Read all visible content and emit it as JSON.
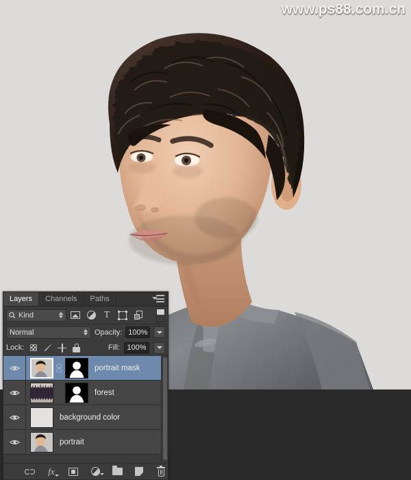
{
  "watermark": {
    "text": "www.ps88.com.cn",
    "sub": "www"
  },
  "canvas": {
    "background_color": "#dcdbd9",
    "outside_color": "#2a2a2a",
    "subject": "portrait photo of young man with curly dark hair wearing gray mandarin-collar shirt"
  },
  "panel": {
    "tabs": [
      {
        "label": "Layers",
        "active": true
      },
      {
        "label": "Channels",
        "active": false
      },
      {
        "label": "Paths",
        "active": false
      }
    ],
    "menu_icon": "panel-menu-icon",
    "filter": {
      "kind_label": "Kind",
      "search_icon": "search-icon",
      "icons": [
        "pixel-layers-filter-icon",
        "adjustment-layers-filter-icon",
        "type-layers-filter-icon",
        "shape-layers-filter-icon",
        "smart-object-filter-icon"
      ],
      "toggle_icon": "filter-toggle-icon"
    },
    "blend": {
      "mode": "Normal",
      "opacity_label": "Opacity:",
      "opacity_value": "100%"
    },
    "lock": {
      "label": "Lock:",
      "icons": [
        "lock-transparent-pixels-icon",
        "lock-image-pixels-icon",
        "lock-position-icon",
        "lock-all-icon"
      ],
      "fill_label": "Fill:",
      "fill_value": "100%"
    },
    "layers": [
      {
        "name": "portrait mask",
        "visible": true,
        "selected": true,
        "has_mask": true,
        "linked": true,
        "thumb_type": "portrait",
        "mask_type": "person-silhouette"
      },
      {
        "name": "forest",
        "visible": true,
        "selected": false,
        "has_mask": true,
        "linked": false,
        "thumb_type": "forest",
        "mask_type": "person-silhouette"
      },
      {
        "name": "background color",
        "visible": true,
        "selected": false,
        "has_mask": false,
        "linked": false,
        "thumb_type": "solid-light",
        "mask_type": null
      },
      {
        "name": "portrait",
        "visible": true,
        "selected": false,
        "has_mask": false,
        "linked": false,
        "thumb_type": "portrait",
        "mask_type": null
      }
    ],
    "bottom_tools": [
      "link-layers-icon",
      "layer-style-fx-icon",
      "add-layer-mask-icon",
      "new-adjustment-layer-icon",
      "new-group-icon",
      "new-layer-icon",
      "delete-layer-icon"
    ],
    "colors": {
      "panel_bg": "#3b3b3b",
      "row_bg": "#454545",
      "selected_row": "#6d89ab",
      "text": "#ececec"
    }
  }
}
